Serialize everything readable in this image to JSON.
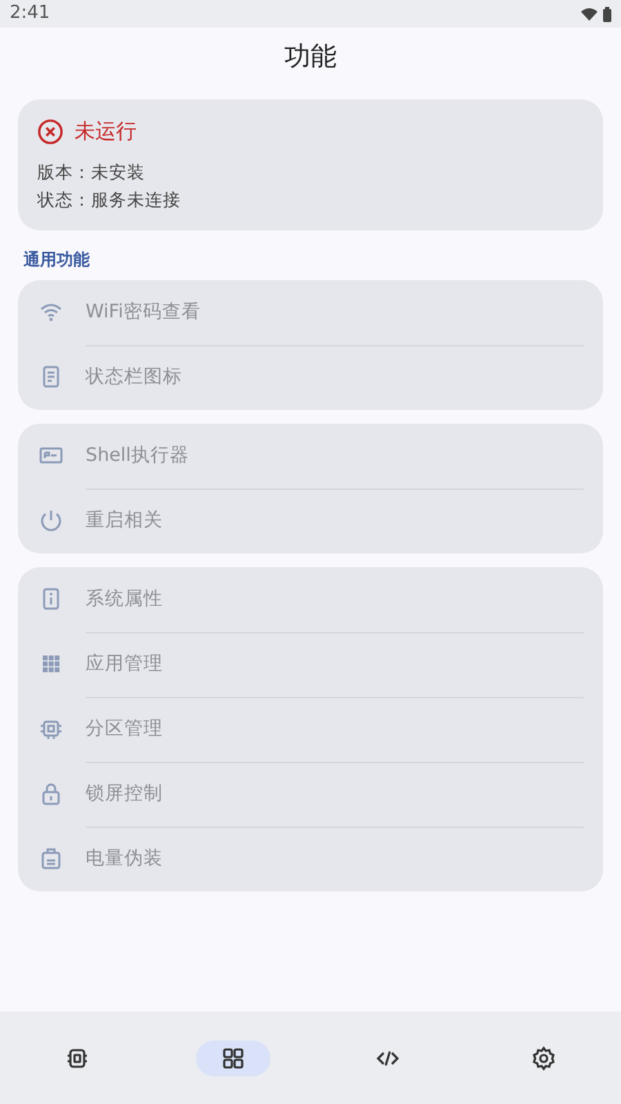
{
  "status_bar": {
    "time": "2:41"
  },
  "title": "功能",
  "status_card": {
    "running": false,
    "title": "未运行",
    "lines": [
      "版本：未安装",
      "状态：服务未连接"
    ]
  },
  "section_label": "通用功能",
  "groups": [
    {
      "items": [
        {
          "label": "WiFi密码查看",
          "disabled": true
        },
        {
          "label": "状态栏图标",
          "disabled": true
        }
      ]
    },
    {
      "items": [
        {
          "label": "Shell执行器",
          "disabled": true
        },
        {
          "label": "重启相关",
          "disabled": true
        }
      ]
    },
    {
      "items": [
        {
          "label": "系统属性",
          "disabled": true
        },
        {
          "label": "应用管理",
          "disabled": true
        },
        {
          "label": "分区管理",
          "disabled": true
        },
        {
          "label": "锁屏控制",
          "disabled": true
        },
        {
          "label": "电量伪装",
          "disabled": true
        }
      ]
    }
  ],
  "bottom_nav": [
    {
      "selected": false
    },
    {
      "selected": true
    },
    {
      "selected": false
    },
    {
      "selected": false
    }
  ]
}
